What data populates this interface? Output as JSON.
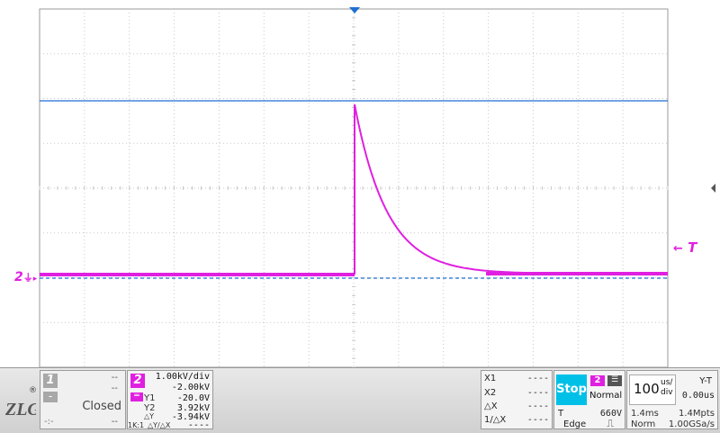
{
  "colors": {
    "ch2": "#e020e0",
    "trigger": "#1f6fd0",
    "grid": "#c8c8c8",
    "stop_bg": "#00c0e8"
  },
  "markers": {
    "ch2_label": "2",
    "trigger_label": "T",
    "trigger_arrow": "←"
  },
  "logo": {
    "registered": "®"
  },
  "channel1": {
    "number": "1",
    "value1": "--",
    "value2": "--",
    "status": "Closed",
    "value3": "--",
    "icon_label": "-:-"
  },
  "channel2": {
    "number": "2",
    "scale": "1.00kV/div",
    "offset": "-2.00kV",
    "y1_label": "Y1",
    "y1_value": "-20.0V",
    "y2_label": "Y2",
    "y2_value": "3.92kV",
    "dy_label": "△Y",
    "dy_value": "-3.94kV",
    "probe": "1K:1",
    "dydx_label": "△Y/△X",
    "dydx_value": "----"
  },
  "cursors": {
    "x1_label": "X1",
    "x1_value": "----",
    "x2_label": "X2",
    "x2_value": "----",
    "dx_label": "△X",
    "dx_value": "----",
    "inv_dx_label": "1/△X",
    "inv_dx_value": "----"
  },
  "run": {
    "state": "Stop"
  },
  "trigger": {
    "channel": "2",
    "mode": "Normal",
    "label": "T",
    "level": "660V",
    "type": "Edge"
  },
  "timebase": {
    "value": "100",
    "unit_top": "us/",
    "unit_bottom": "div",
    "mode": "Y-T",
    "delay": "0.00us",
    "window": "1.4ms",
    "memory": "1.4Mpts",
    "acq_mode": "Norm",
    "sample_rate": "1.00GSa/s"
  }
}
